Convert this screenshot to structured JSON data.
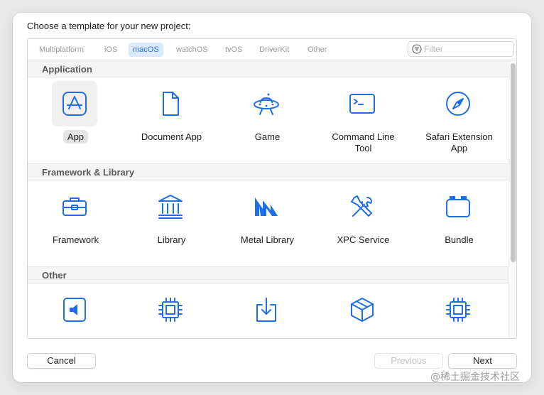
{
  "dialog": {
    "prompt": "Choose a template for your new project:"
  },
  "platform_tabs": [
    {
      "label": "Multiplatform",
      "selected": false
    },
    {
      "label": "iOS",
      "selected": false
    },
    {
      "label": "macOS",
      "selected": true
    },
    {
      "label": "watchOS",
      "selected": false
    },
    {
      "label": "tvOS",
      "selected": false
    },
    {
      "label": "DriverKit",
      "selected": false
    },
    {
      "label": "Other",
      "selected": false
    }
  ],
  "filter": {
    "placeholder": "Filter",
    "icon": "filter-icon"
  },
  "sections": [
    {
      "title": "Application",
      "items": [
        {
          "label": "App",
          "icon": "app-store-icon",
          "selected": true
        },
        {
          "label": "Document App",
          "icon": "document-icon"
        },
        {
          "label": "Game",
          "icon": "game-ufo-icon"
        },
        {
          "label": "Command Line Tool",
          "icon": "terminal-icon"
        },
        {
          "label": "Safari Extension App",
          "icon": "compass-icon"
        }
      ]
    },
    {
      "title": "Framework & Library",
      "items": [
        {
          "label": "Framework",
          "icon": "toolbox-icon"
        },
        {
          "label": "Library",
          "icon": "library-columns-icon"
        },
        {
          "label": "Metal Library",
          "icon": "metal-icon"
        },
        {
          "label": "XPC Service",
          "icon": "tools-icon"
        },
        {
          "label": "Bundle",
          "icon": "bundle-icon"
        }
      ]
    },
    {
      "title": "Other",
      "items": [
        {
          "label": "",
          "icon": "audio-unit-icon"
        },
        {
          "label": "",
          "icon": "chip-icon"
        },
        {
          "label": "",
          "icon": "installer-icon"
        },
        {
          "label": "",
          "icon": "package-box-icon"
        },
        {
          "label": "",
          "icon": "chip-icon"
        }
      ]
    }
  ],
  "buttons": {
    "cancel": "Cancel",
    "previous": "Previous",
    "next": "Next"
  },
  "watermark": "@稀土掘金技术社区",
  "colors": {
    "accent": "#1e6ee6",
    "tab_selected_bg": "#d9e9ff"
  }
}
